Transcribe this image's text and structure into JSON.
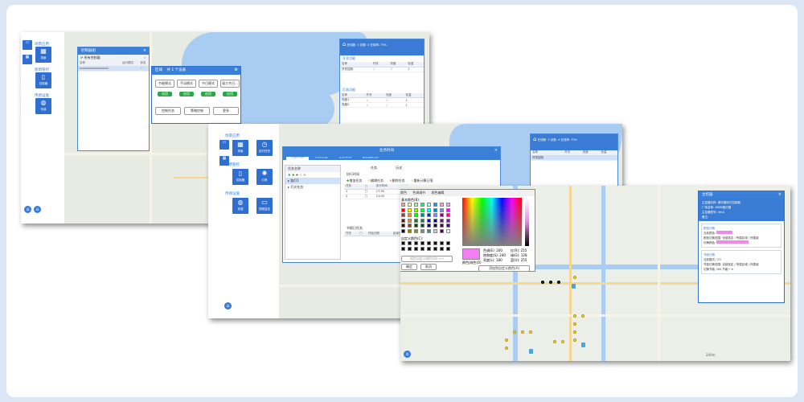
{
  "shot1": {
    "sidebar": {
      "section1": "场景应用",
      "section2": "照明管控",
      "section3": "传感设施",
      "tiles": [
        {
          "icon": "grid-icon",
          "label": "场景"
        },
        {
          "icon": "phone-icon",
          "label": "控制器"
        },
        {
          "icon": "globe-icon",
          "label": "传感"
        }
      ],
      "left_icons": [
        "场景编辑",
        "定时任务"
      ]
    },
    "list_window": {
      "title": "控制器组",
      "toolbar_label": "所有控制器",
      "columns": [
        "名称",
        "运行模式",
        "状态"
      ]
    },
    "mode_panel": {
      "title": "区域",
      "subtitle": "共 1 个设备",
      "mode_buttons": [
        "节能模式",
        "手动模式",
        "节日模式",
        "极大节日..."
      ],
      "apply_labels": [
        "启用",
        "启用",
        "启用",
        "启用"
      ],
      "bottom_buttons": [
        "控制任务",
        "策略控制",
        "更多"
      ]
    },
    "status_window": {
      "summary": "在线数: 3  总数: 4  在线率: 75%",
      "sections": [
        {
          "title": "开关功能",
          "rows": [
            [
              "开关控制",
              "✓",
              "✓",
              "1"
            ]
          ]
        },
        {
          "title": "灯具功能",
          "rows": [
            [
              "亮度1",
              "✓",
              "✓",
              "1"
            ],
            [
              "亮度2",
              "✓",
              "✓",
              "1"
            ]
          ]
        }
      ],
      "columns": [
        "名称",
        "开关",
        "亮度",
        "色温"
      ]
    },
    "map_label": "城市街道"
  },
  "shot2": {
    "sidebar": {
      "section1": "场景应用",
      "section2": "照明管控",
      "section3": "传感设施",
      "tiles": [
        {
          "icon": "grid-icon",
          "label": "场景"
        },
        {
          "icon": "clock-icon",
          "label": "定时任务"
        },
        {
          "icon": "phone-icon",
          "label": "控制器"
        },
        {
          "icon": "bulb-icon",
          "label": "灯具"
        },
        {
          "icon": "globe-icon",
          "label": "传感"
        },
        {
          "icon": "monitor-icon",
          "label": "视频监控"
        }
      ]
    },
    "task_window": {
      "title": "任务时间",
      "tabs": [
        "任务列表",
        "灯具分组",
        "任务详情",
        "路由器控制"
      ],
      "left_header": "任务名称",
      "left_rows": [
        "路灯1",
        "灯光任务"
      ],
      "sub_tabs": [
        "任务",
        "历史"
      ],
      "section_title": "执行时间",
      "actions": [
        "增加任务",
        "编辑任务",
        "删除任务",
        "重新计算日落"
      ],
      "columns": [
        "任务",
        "",
        "执行时间"
      ],
      "time_rows": [
        [
          "1",
          "17:30"
        ],
        [
          "2",
          "21:00"
        ]
      ],
      "section2_title": "节假日任务",
      "columns2": [
        "任务",
        "",
        "开始日期",
        "结束日期"
      ]
    },
    "status_window": {
      "summary": "在线数: 3  总数: 4  在线率: 75%",
      "columns": [
        "名称",
        "开关",
        "亮度",
        "色温"
      ],
      "rows": [
        [
          "开关控制",
          "",
          "",
          ""
        ]
      ]
    }
  },
  "shot3": {
    "color_dialog": {
      "tabs": [
        "颜色",
        "色调调节",
        "颜色编辑"
      ],
      "basic_colors_label": "基本颜色(B):",
      "custom_colors_label": "自定义颜色(C):",
      "define_button": "规定自定义颜色(D) >>",
      "ok_button": "确定",
      "cancel_button": "取消",
      "add_button": "添加到自定义颜色(A)",
      "hue_label": "色调(E):",
      "hue_value": "200",
      "sat_label": "饱和度(S):",
      "sat_value": "240",
      "lum_label": "亮度(L):",
      "lum_value": "180",
      "red_label": "红(R):",
      "red_value": "255",
      "green_label": "绿(G):",
      "green_value": "128",
      "blue_label": "蓝(U):",
      "blue_value": "255",
      "solid_label": "颜色|纯色(O)",
      "preview_color": "#f27ff2"
    },
    "info_panel": {
      "title": "主控器",
      "fields": [
        {
          "label": "主控器名称:",
          "value": "顺华路街灯控制器"
        },
        {
          "label": "厂商名称:",
          "value": "4B5B路灯器"
        },
        {
          "label": "主控器型号:",
          "value": "4mA"
        },
        {
          "label": "备注:",
          "value": ""
        }
      ],
      "section_color": "颜色切换",
      "current_color_label": "当前颜色:",
      "range_label": "颜色切换范围:",
      "range_options": "全部选定 / 所属区域 / 所属组",
      "switch_color_label": "切换颜色:",
      "section_mode": "节能切换",
      "mode_current_label": "当前模式:",
      "mode_current": "DIS",
      "mode_range_label": "节能切换范围:",
      "mode_options": "全部选定 / 所属区域 / 所属组",
      "mode_switch_label": "切换节能:",
      "mode_switch_value": "DIS 节能一",
      "color_pink": "#f088e8"
    },
    "scale_label": "200m"
  }
}
